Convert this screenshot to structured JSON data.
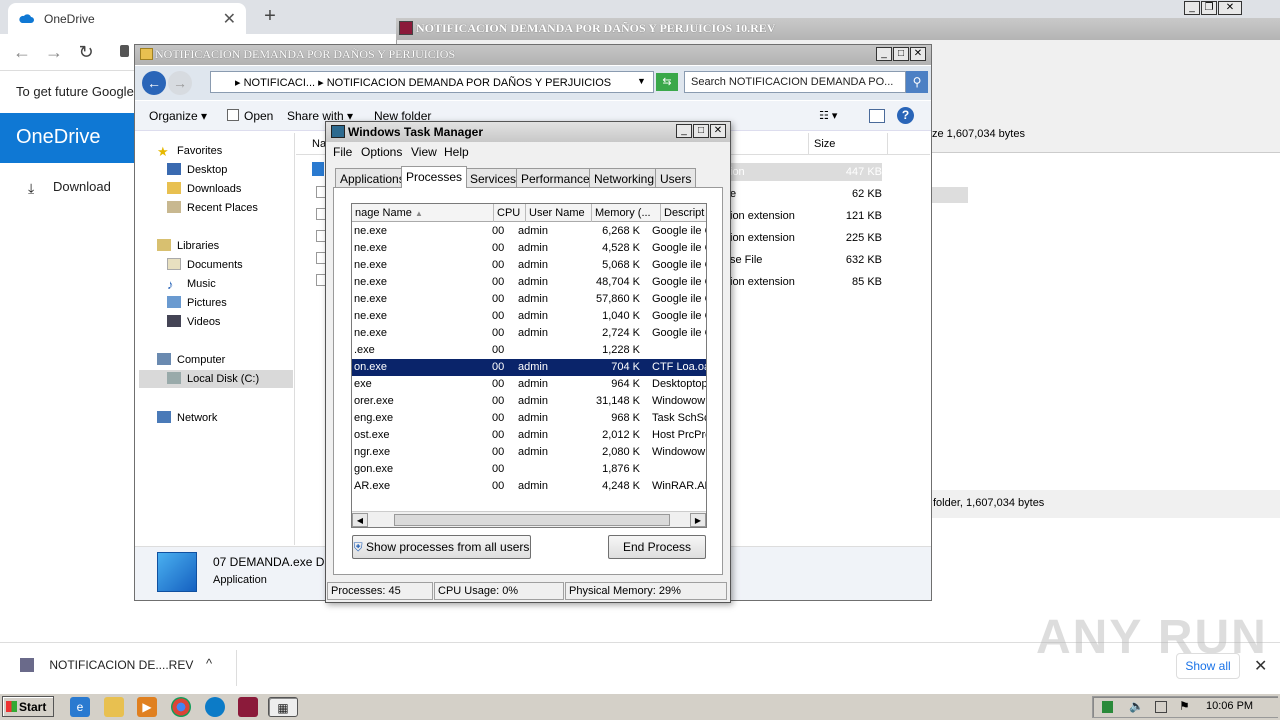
{
  "chrome": {
    "tab_title": "OneDrive",
    "tab_close": "✕",
    "new_tab": "+",
    "infobar_text": "To get future Google"
  },
  "onedrive": {
    "header": "OneDrive",
    "download_label": "Download",
    "brand_color": "#0f78d4"
  },
  "winrar": {
    "title": "NOTIFICACION DEMANDA POR DAÑOS Y PERJUICIOS 10.REV",
    "info_text": "ze 1,607,034 bytes",
    "status_text": "folder, 1,607,034 bytes"
  },
  "explorer": {
    "title": "NOTIFICACION DEMANDA POR DAÑOS Y PERJUICIOS",
    "address": "▸ NOTIFICACI... ▸ NOTIFICACION DEMANDA POR DAÑOS Y PERJUICIOS",
    "search_placeholder": "Search NOTIFICACION DEMANDA PO...",
    "commands": {
      "organize": "Organize ▾",
      "open": "Open",
      "share_with": "Share with ▾",
      "new_folder": "New folder"
    },
    "nav": {
      "favorites": "Favorites",
      "desktop": "Desktop",
      "downloads": "Downloads",
      "recent_places": "Recent Places",
      "libraries": "Libraries",
      "documents": "Documents",
      "music": "Music",
      "pictures": "Pictures",
      "videos": "Videos",
      "computer": "Computer",
      "local_disk": "Local Disk (C:)",
      "network": "Network"
    },
    "columns": {
      "name": "Na",
      "size": "Size"
    },
    "files": [
      {
        "type": "ion",
        "size": "447 KB"
      },
      {
        "type": "e",
        "size": "62 KB"
      },
      {
        "type": "ion extension",
        "size": "121 KB"
      },
      {
        "type": "ion extension",
        "size": "225 KB"
      },
      {
        "type": "se File",
        "size": "632 KB"
      },
      {
        "type": "ion extension",
        "size": "85 KB"
      }
    ],
    "details": {
      "name": "07 DEMANDA.exe D",
      "type": "Application"
    }
  },
  "taskmgr": {
    "title": "Windows Task Manager",
    "menu": {
      "file": "File",
      "options": "Options",
      "view": "View",
      "help": "Help"
    },
    "tabs": {
      "applications": "Applications",
      "processes": "Processes",
      "services": "Services",
      "performance": "Performance",
      "networking": "Networking",
      "users": "Users"
    },
    "columns": {
      "image_name": "nage Name",
      "cpu": "CPU",
      "user_name": "User Name",
      "memory": "Memory (...",
      "description": "Descript"
    },
    "processes": [
      {
        "name": "ne.exe",
        "cpu": "00",
        "user": "admin",
        "mem": "6,268 K",
        "desc": "Google  ile  C"
      },
      {
        "name": "ne.exe",
        "cpu": "00",
        "user": "admin",
        "mem": "4,528 K",
        "desc": "Google  ile  C"
      },
      {
        "name": "ne.exe",
        "cpu": "00",
        "user": "admin",
        "mem": "5,068 K",
        "desc": "Google  ile  C"
      },
      {
        "name": "ne.exe",
        "cpu": "00",
        "user": "admin",
        "mem": "48,704 K",
        "desc": "Google  ile  C"
      },
      {
        "name": "ne.exe",
        "cpu": "00",
        "user": "admin",
        "mem": "57,860 K",
        "desc": "Google  ile  C"
      },
      {
        "name": "ne.exe",
        "cpu": "00",
        "user": "admin",
        "mem": "1,040 K",
        "desc": "Google  ile  C"
      },
      {
        "name": "ne.exe",
        "cpu": "00",
        "user": "admin",
        "mem": "2,724 K",
        "desc": "Google  ile  C"
      },
      {
        "name": ".exe",
        "cpu": "00",
        "user": "",
        "mem": "1,228 K",
        "desc": ""
      },
      {
        "name": "on.exe",
        "cpu": "00",
        "user": "admin",
        "mem": "704 K",
        "desc": "CTF Loa.oa"
      },
      {
        "name": "exe",
        "cpu": "00",
        "user": "admin",
        "mem": "964 K",
        "desc": "Desktoptop"
      },
      {
        "name": "orer.exe",
        "cpu": "00",
        "user": "admin",
        "mem": "31,148 K",
        "desc": "Windowow"
      },
      {
        "name": "eng.exe",
        "cpu": "00",
        "user": "admin",
        "mem": "968 K",
        "desc": "Task SchSch"
      },
      {
        "name": "ost.exe",
        "cpu": "00",
        "user": "admin",
        "mem": "2,012 K",
        "desc": "Host PrcPro"
      },
      {
        "name": "ngr.exe",
        "cpu": "00",
        "user": "admin",
        "mem": "2,080 K",
        "desc": "Windowow"
      },
      {
        "name": "gon.exe",
        "cpu": "00",
        "user": "",
        "mem": "1,876 K",
        "desc": ""
      },
      {
        "name": "AR.exe",
        "cpu": "00",
        "user": "admin",
        "mem": "4,248 K",
        "desc": "WinRAR.AR"
      }
    ],
    "show_all_button": "Show processes from all users",
    "end_process_button": "End Process",
    "status": {
      "processes": "Processes: 45",
      "cpu": "CPU Usage: 0%",
      "memory": "Physical Memory: 29%"
    },
    "selection_color": "#0a246a"
  },
  "download_bar": {
    "item_name": "NOTIFICACION DE....REV",
    "chevron": "^",
    "show_all": "Show all",
    "close": "✕"
  },
  "watermark": "ANY RUN",
  "taskbar": {
    "start": "Start",
    "clock": "10:06 PM"
  }
}
